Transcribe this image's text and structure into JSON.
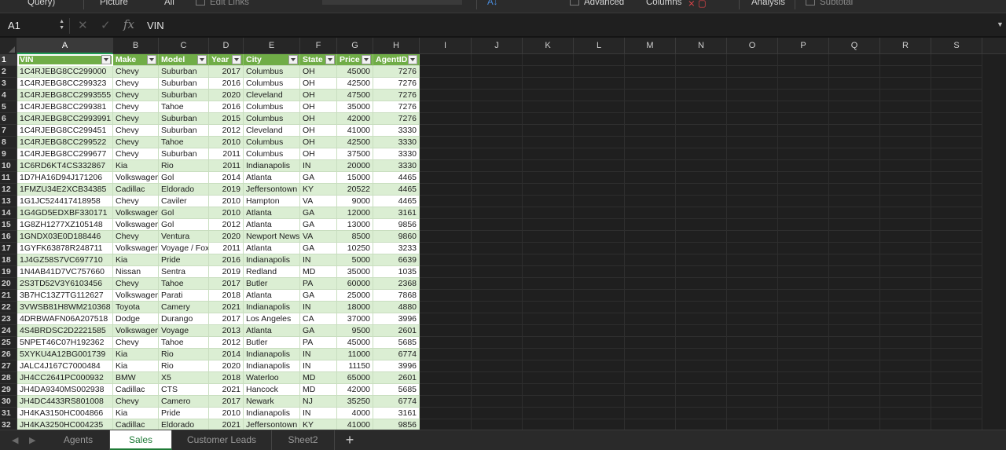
{
  "ribbon": {
    "query": "Query)",
    "picture": "Picture",
    "all": "All",
    "edit_links": "Edit Links",
    "advanced": "Advanced",
    "columns": "Columns",
    "analysis": "Analysis",
    "subtotal": "Subtotal"
  },
  "formula_bar": {
    "name_box": "A1",
    "fx": "fx",
    "value": "VIN"
  },
  "columns": [
    "A",
    "B",
    "C",
    "D",
    "E",
    "F",
    "G",
    "H",
    "I",
    "J",
    "K",
    "L",
    "M",
    "N",
    "O",
    "P",
    "Q",
    "R",
    "S"
  ],
  "selected_column": "A",
  "header_row": [
    "VIN",
    "Make",
    "Model",
    "Year",
    "City",
    "State",
    "Price",
    "AgentID"
  ],
  "rows": [
    [
      "1C4RJEBG8CC299000",
      "Chevy",
      "Suburban",
      "2017",
      "Columbus",
      "OH",
      "45000",
      "7276"
    ],
    [
      "1C4RJEBG8CC299323",
      "Chevy",
      "Suburban",
      "2016",
      "Columbus",
      "OH",
      "42500",
      "7276"
    ],
    [
      "1C4RJEBG8CC2993555",
      "Chevy",
      "Suburban",
      "2020",
      "Cleveland",
      "OH",
      "47500",
      "7276"
    ],
    [
      "1C4RJEBG8CC299381",
      "Chevy",
      "Tahoe",
      "2016",
      "Columbus",
      "OH",
      "35000",
      "7276"
    ],
    [
      "1C4RJEBG8CC2993991",
      "Chevy",
      "Suburban",
      "2015",
      "Columbus",
      "OH",
      "42000",
      "7276"
    ],
    [
      "1C4RJEBG8CC299451",
      "Chevy",
      "Suburban",
      "2012",
      "Cleveland",
      "OH",
      "41000",
      "3330"
    ],
    [
      "1C4RJEBG8CC299522",
      "Chevy",
      "Tahoe",
      "2010",
      "Columbus",
      "OH",
      "42500",
      "3330"
    ],
    [
      "1C4RJEBG8CC299677",
      "Chevy",
      "Suburban",
      "2011",
      "Columbus",
      "OH",
      "37500",
      "3330"
    ],
    [
      "1C6RD6KT4CS332867",
      "Kia",
      "Rio",
      "2011",
      "Indianapolis",
      "IN",
      "20000",
      "3330"
    ],
    [
      "1D7HA16D94J171206",
      "Volkswagen",
      "Gol",
      "2014",
      "Atlanta",
      "GA",
      "15000",
      "4465"
    ],
    [
      "1FMZU34E2XCB34385",
      "Cadillac",
      "Eldorado",
      "2019",
      "Jeffersontown",
      "KY",
      "20522",
      "4465"
    ],
    [
      "1G1JC524417418958",
      "Chevy",
      "Caviler",
      "2010",
      "Hampton",
      "VA",
      "9000",
      "4465"
    ],
    [
      "1G4GD5EDXBF330171",
      "Volkswagen",
      "Gol",
      "2010",
      "Atlanta",
      "GA",
      "12000",
      "3161"
    ],
    [
      "1G8ZH1277XZ105148",
      "Volkswagen",
      "Gol",
      "2012",
      "Atlanta",
      "GA",
      "13000",
      "9856"
    ],
    [
      "1GNDX03E0D188446",
      "Chevy",
      "Ventura",
      "2020",
      "Newport News",
      "VA",
      "8500",
      "9860"
    ],
    [
      "1GYFK63878R248711",
      "Volkswagen",
      "Voyage / Fox",
      "2011",
      "Atlanta",
      "GA",
      "10250",
      "3233"
    ],
    [
      "1J4GZ58S7VC697710",
      "Kia",
      "Pride",
      "2016",
      "Indianapolis",
      "IN",
      "5000",
      "6639"
    ],
    [
      "1N4AB41D7VC757660",
      "Nissan",
      "Sentra",
      "2019",
      "Redland",
      "MD",
      "35000",
      "1035"
    ],
    [
      "2S3TD52V3Y6103456",
      "Chevy",
      "Tahoe",
      "2017",
      "Butler",
      "PA",
      "60000",
      "2368"
    ],
    [
      "3B7HC13Z7TG112627",
      "Volkswagen",
      "Parati",
      "2018",
      "Atlanta",
      "GA",
      "25000",
      "7868"
    ],
    [
      "3VWSB81H8WM210368",
      "Toyota",
      "Camery",
      "2021",
      "Indianapolis",
      "IN",
      "18000",
      "4880"
    ],
    [
      "4DRBWAFN06A207518",
      "Dodge",
      "Durango",
      "2017",
      "Los Angeles",
      "CA",
      "37000",
      "3996"
    ],
    [
      "4S4BRDSC2D2221585",
      "Volkswagen",
      "Voyage",
      "2013",
      "Atlanta",
      "GA",
      "9500",
      "2601"
    ],
    [
      "5NPET46C07H192362",
      "Chevy",
      "Tahoe",
      "2012",
      "Butler",
      "PA",
      "45000",
      "5685"
    ],
    [
      "5XYKU4A12BG001739",
      "Kia",
      "Rio",
      "2014",
      "Indianapolis",
      "IN",
      "11000",
      "6774"
    ],
    [
      "JALC4J167C7000484",
      "Kia",
      "Rio",
      "2020",
      "Indianapolis",
      "IN",
      "11150",
      "3996"
    ],
    [
      "JH4CC2641PC000932",
      "BMW",
      "X5",
      "2018",
      "Waterloo",
      "MD",
      "65000",
      "2601"
    ],
    [
      "JH4DA9340MS002938",
      "Cadillac",
      "CTS",
      "2021",
      "Hancock",
      "MD",
      "42000",
      "5685"
    ],
    [
      "JH4DC4433RS801008",
      "Chevy",
      "Camero",
      "2017",
      "Newark",
      "NJ",
      "35250",
      "6774"
    ],
    [
      "JH4KA3150HC004866",
      "Kia",
      "Pride",
      "2010",
      "Indianapolis",
      "IN",
      "4000",
      "3161"
    ],
    [
      "JH4KA3250HC004235",
      "Cadillac",
      "Eldorado",
      "2021",
      "Jeffersontown",
      "KY",
      "41000",
      "9856"
    ]
  ],
  "sheet_tabs": [
    {
      "label": "Agents",
      "active": false
    },
    {
      "label": "Sales",
      "active": true
    },
    {
      "label": "Customer Leads",
      "active": false
    },
    {
      "label": "Sheet2",
      "active": false
    }
  ],
  "add_sheet_label": "+",
  "icons": {
    "nav_prev": "triangle-left-icon",
    "nav_next": "triangle-right-icon",
    "filter": "filter-dropdown-icon"
  },
  "colors": {
    "header_green": "#70ad47",
    "band_green": "#dbeed3",
    "active_tab_text": "#1e7a36"
  }
}
